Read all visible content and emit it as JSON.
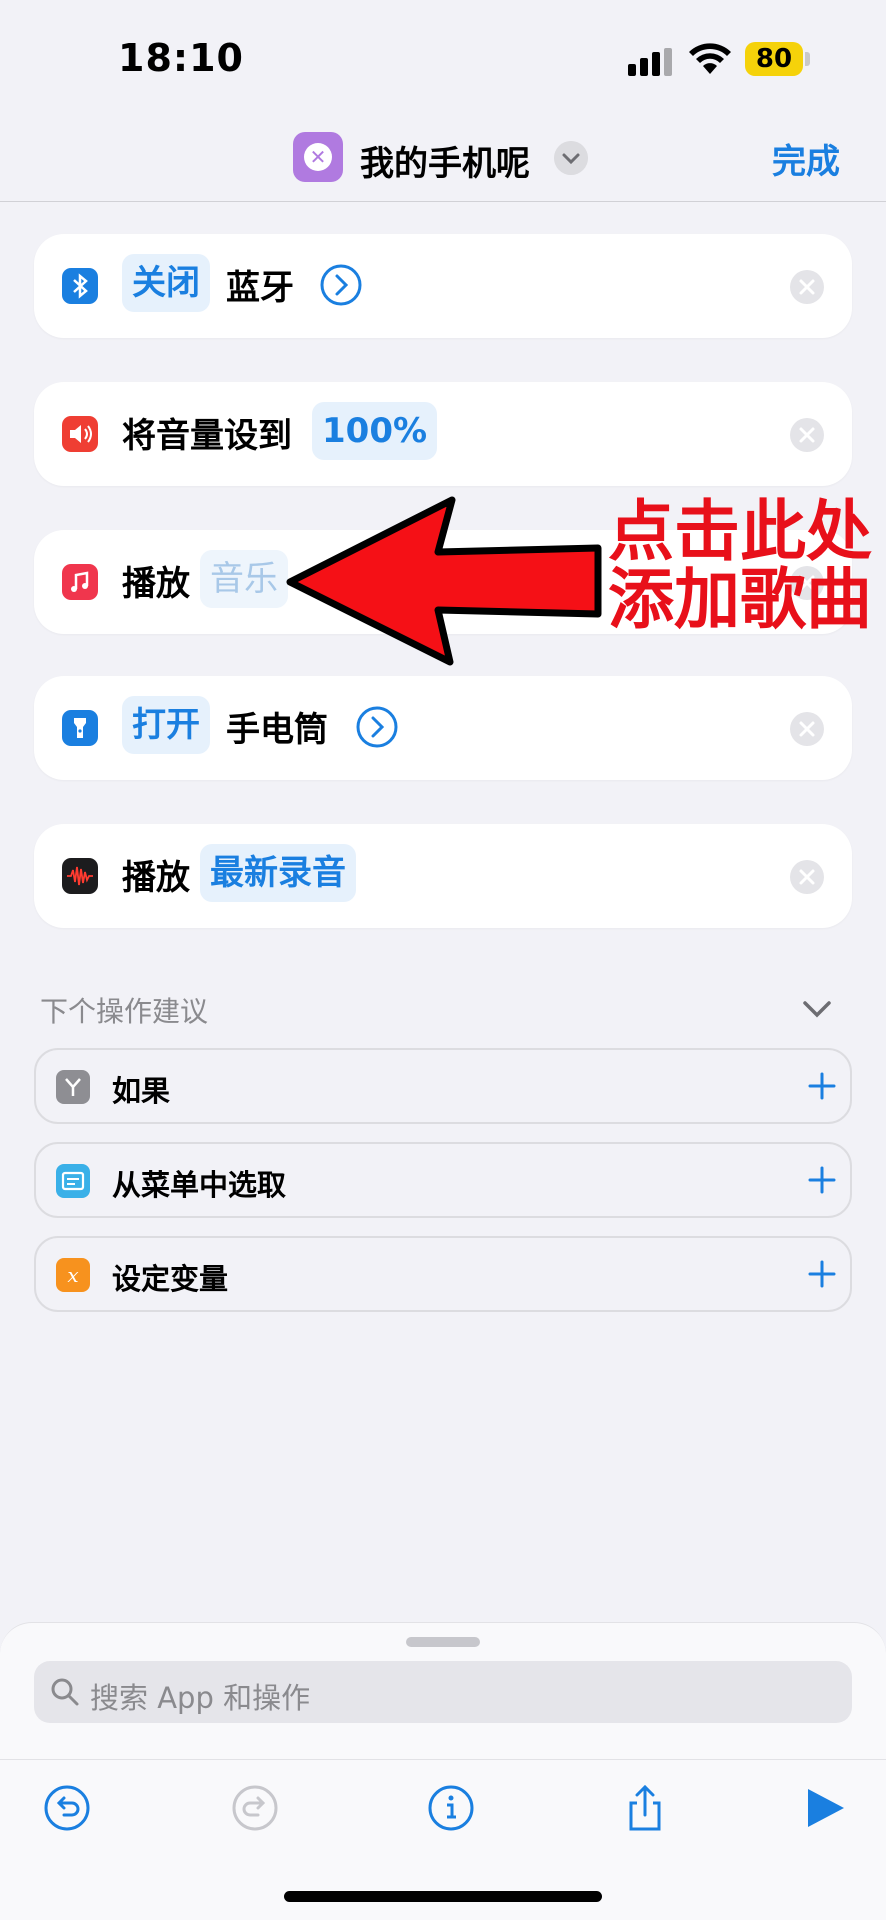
{
  "status": {
    "time": "18:10",
    "battery": "80"
  },
  "nav": {
    "title": "我的手机呢",
    "done_label": "完成"
  },
  "actions": [
    {
      "icon": "bluetooth-icon",
      "token": "关闭",
      "text": "蓝牙"
    },
    {
      "icon": "speaker-icon",
      "text": "将音量设到",
      "token": "100%"
    },
    {
      "icon": "music-icon",
      "text": "播放",
      "placeholder": "音乐"
    },
    {
      "icon": "flashlight-icon",
      "token": "打开",
      "text": "手电筒"
    },
    {
      "icon": "voice-memos-icon",
      "text": "播放",
      "token": "最新录音"
    }
  ],
  "annotation": {
    "line1": "点击此处",
    "line2": "添加歌曲"
  },
  "suggestions": {
    "title": "下个操作建议",
    "items": [
      {
        "icon": "if-icon",
        "label": "如果"
      },
      {
        "icon": "menu-icon",
        "label": "从菜单中选取"
      },
      {
        "icon": "variable-icon",
        "label": "设定变量"
      }
    ]
  },
  "search": {
    "placeholder": "搜索 App 和操作"
  },
  "colors": {
    "accent": "#1a7fe0",
    "annotation_red": "#e8101a",
    "background": "#f2f2f7"
  }
}
